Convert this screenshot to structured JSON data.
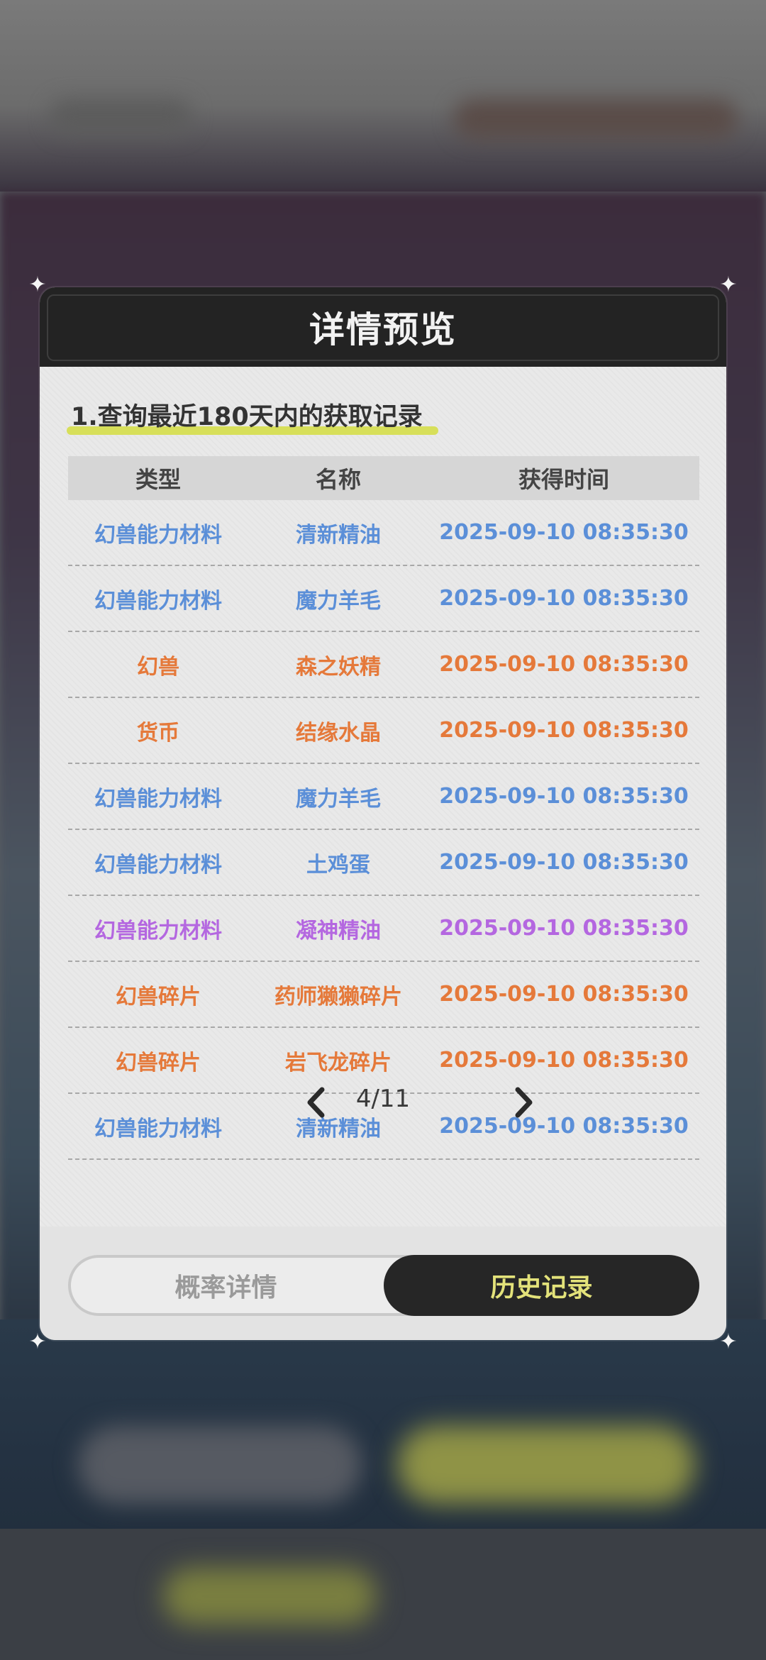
{
  "dialog": {
    "title": "详情预览",
    "section_title": "1.查询最近180天内的获取记录"
  },
  "table": {
    "headers": [
      "类型",
      "名称",
      "获得时间"
    ],
    "rows": [
      {
        "type": "幻兽能力材料",
        "name": "清新精油",
        "time": "2025-09-10 08:35:30",
        "color": "#5b8fd8"
      },
      {
        "type": "幻兽能力材料",
        "name": "魔力羊毛",
        "time": "2025-09-10 08:35:30",
        "color": "#5b8fd8"
      },
      {
        "type": "幻兽",
        "name": "森之妖精",
        "time": "2025-09-10 08:35:30",
        "color": "#e5793a"
      },
      {
        "type": "货币",
        "name": "结缘水晶",
        "time": "2025-09-10 08:35:30",
        "color": "#e5793a"
      },
      {
        "type": "幻兽能力材料",
        "name": "魔力羊毛",
        "time": "2025-09-10 08:35:30",
        "color": "#5b8fd8"
      },
      {
        "type": "幻兽能力材料",
        "name": "土鸡蛋",
        "time": "2025-09-10 08:35:30",
        "color": "#5b8fd8"
      },
      {
        "type": "幻兽能力材料",
        "name": "凝神精油",
        "time": "2025-09-10 08:35:30",
        "color": "#b467e0"
      },
      {
        "type": "幻兽碎片",
        "name": "药师獭獭碎片",
        "time": "2025-09-10 08:35:30",
        "color": "#e5793a"
      },
      {
        "type": "幻兽碎片",
        "name": "岩飞龙碎片",
        "time": "2025-09-10 08:35:30",
        "color": "#e5793a"
      },
      {
        "type": "幻兽能力材料",
        "name": "清新精油",
        "time": "2025-09-10 08:35:30",
        "color": "#5b8fd8"
      }
    ]
  },
  "pager": {
    "current": 4,
    "total": 11,
    "text": "4/11",
    "prev_icon": "chevron-left-icon",
    "next_icon": "chevron-right-icon"
  },
  "tabs": {
    "inactive_label": "概率详情",
    "active_label": "历史记录"
  },
  "colors": {
    "header_bg": "#232323",
    "active_tab_bg": "#262626",
    "active_tab_text": "#e3e27a",
    "highlight": "#d7df5a",
    "blue": "#5b8fd8",
    "orange": "#e5793a",
    "purple": "#b467e0"
  }
}
